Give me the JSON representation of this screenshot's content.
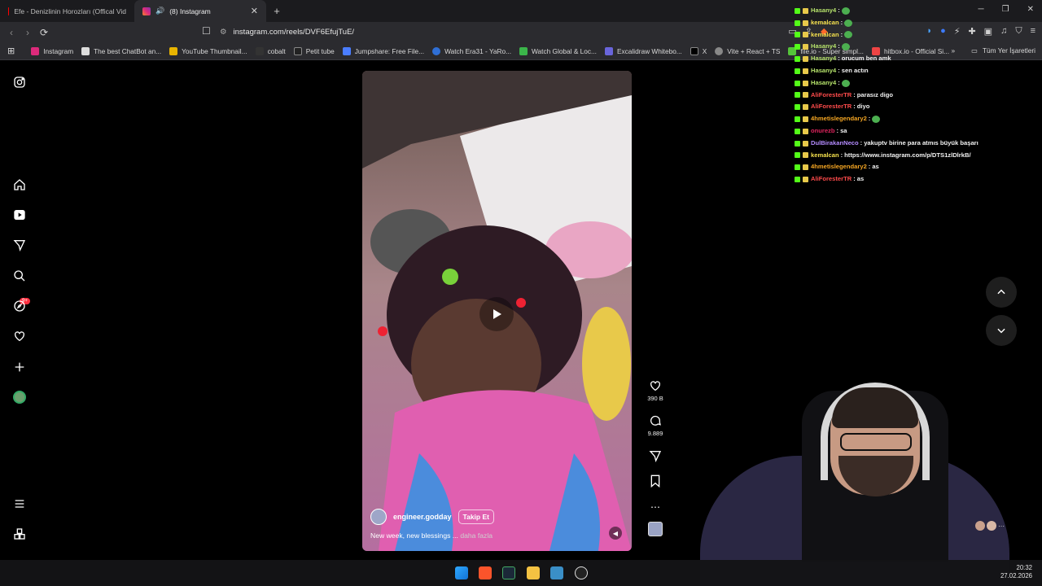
{
  "browser": {
    "tabs": [
      {
        "title": "Efe - Denizlinin Horozları (Offical Vid",
        "active": false
      },
      {
        "title": "(8) Instagram",
        "active": true
      }
    ],
    "url": "instagram.com/reels/DVF6EfujTuE/",
    "bookmarks": [
      "Instagram",
      "The best ChatBot an...",
      "YouTube Thumbnail...",
      "cobalt",
      "Petit tube",
      "Jumpshare: Free File...",
      "Watch Era31 - YaRo...",
      "Watch Global & Loc...",
      "Excalidraw Whitebo...",
      "X",
      "Vite + React + TS",
      "file.io - Super simpl...",
      "hitbox.io - Official Si..."
    ],
    "all_bookmarks": "Tüm Yer İşaretleri"
  },
  "sidebar": {
    "notification_badge": "9+"
  },
  "reel": {
    "username": "engineer.godday",
    "follow_label": "Takip Et",
    "caption": "New week, new blessings ...",
    "more_label": "daha fazla",
    "likes": "390 B",
    "comments": "9.889"
  },
  "chat": [
    {
      "user": "Hasany4",
      "msg": "",
      "color": "#b6e36b",
      "emote": true
    },
    {
      "user": "kemalcan",
      "msg": "",
      "color": "#f4e04d",
      "emote": true
    },
    {
      "user": "kemalcan",
      "msg": "",
      "color": "#f4e04d",
      "emote": true
    },
    {
      "user": "Hasany4",
      "msg": "",
      "color": "#b6e36b",
      "emote": true
    },
    {
      "user": "Hasany4",
      "msg": "orucum ben amk",
      "color": "#b6e36b",
      "emote": false
    },
    {
      "user": "Hasany4",
      "msg": "sen actın",
      "color": "#b6e36b",
      "emote": false
    },
    {
      "user": "Hasany4",
      "msg": "",
      "color": "#b6e36b",
      "emote": true
    },
    {
      "user": "AliForesterTR",
      "msg": "parasız digo",
      "color": "#ff4b4b",
      "emote": false
    },
    {
      "user": "AliForesterTR",
      "msg": "diyo",
      "color": "#ff4b4b",
      "emote": false
    },
    {
      "user": "4hmetislegendary2",
      "msg": "",
      "color": "#f5a623",
      "emote": true
    },
    {
      "user": "onurezb",
      "msg": "sa",
      "color": "#e0245e",
      "emote": false
    },
    {
      "user": "DulBirakanNeco",
      "msg": "yakuptv birine para atmıs büyük başarı",
      "color": "#b48cff",
      "emote": false
    },
    {
      "user": "kemalcan",
      "msg": "https://www.instagram.com/p/DTS1zlDlrkB/",
      "color": "#f4e04d",
      "emote": false
    },
    {
      "user": "4hmetislegendary2",
      "msg": "as",
      "color": "#f5a623",
      "emote": false
    },
    {
      "user": "AliForesterTR",
      "msg": "as",
      "color": "#ff4b4b",
      "emote": false
    }
  ],
  "taskbar": {
    "time": "20:32",
    "date": "27.02.2026"
  }
}
